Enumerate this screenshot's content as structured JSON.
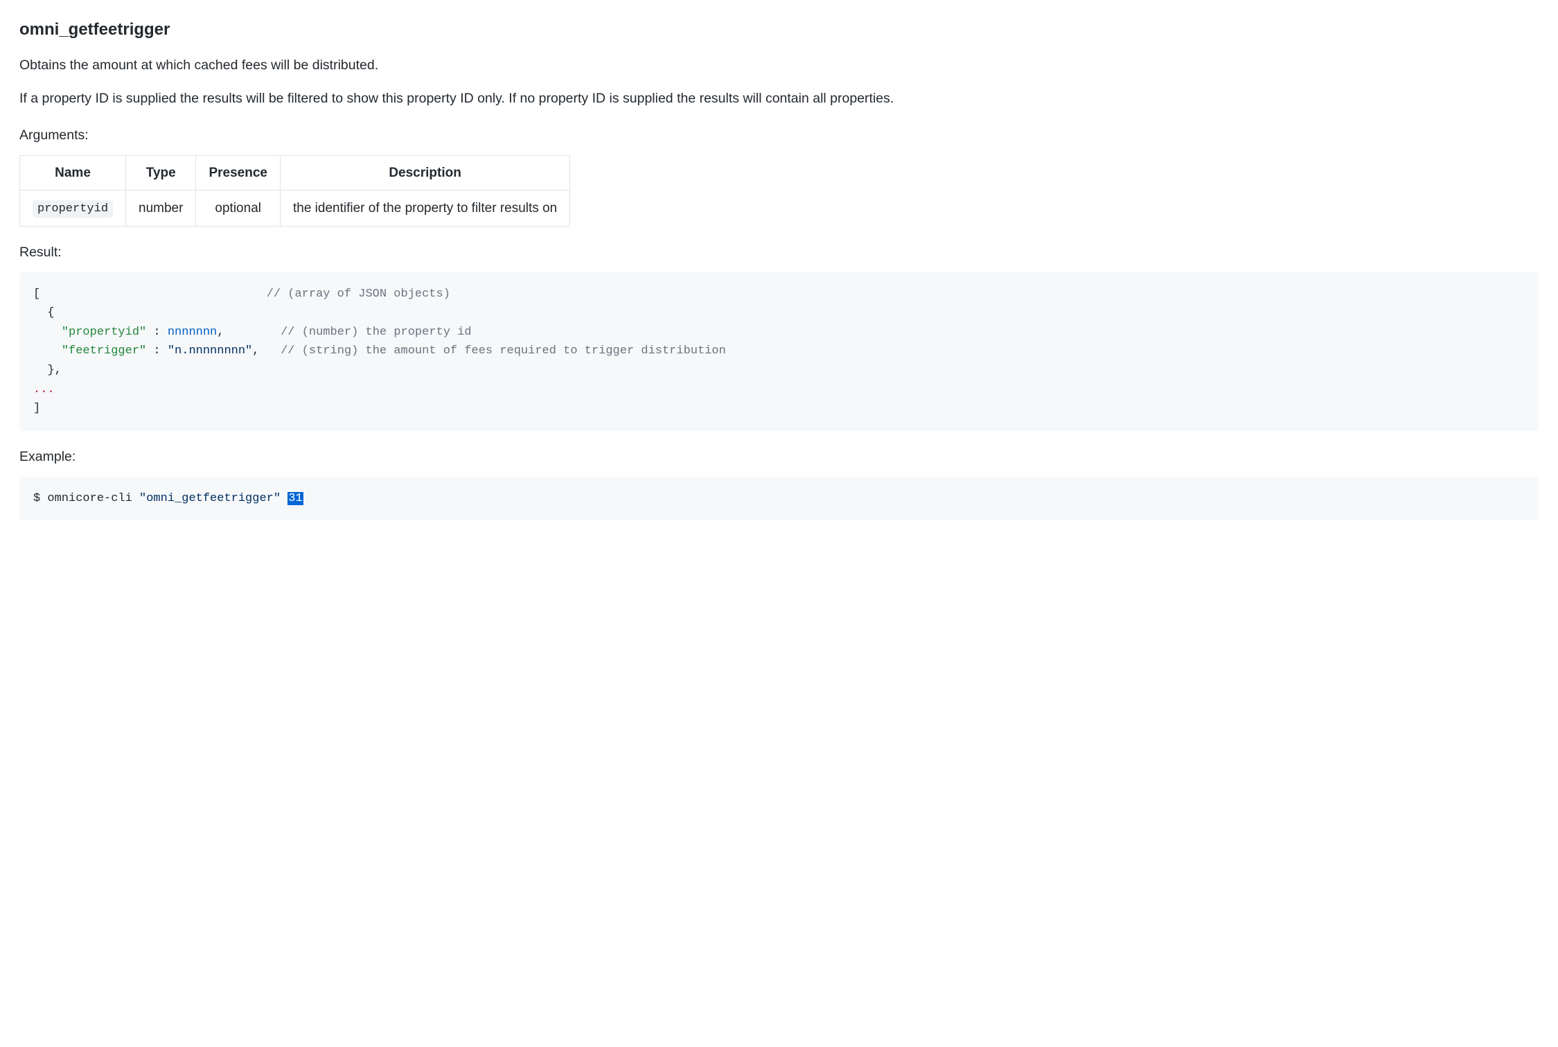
{
  "title": "omni_getfeetrigger",
  "description": [
    "Obtains the amount at which cached fees will be distributed.",
    "If a property ID is supplied the results will be filtered to show this property ID only. If no property ID is supplied the results will contain all properties."
  ],
  "argumentsLabel": "Arguments:",
  "argumentsTable": {
    "headers": [
      "Name",
      "Type",
      "Presence",
      "Description"
    ],
    "rows": [
      {
        "name": "propertyid",
        "type": "number",
        "presence": "optional",
        "description": "the identifier of the property to filter results on"
      }
    ]
  },
  "resultLabel": "Result:",
  "resultCode": {
    "lines": [
      {
        "parts": [
          {
            "t": "[                                ",
            "cls": "tok-p"
          },
          {
            "t": "// (array of JSON objects)",
            "cls": "tok-c"
          }
        ]
      },
      {
        "parts": [
          {
            "t": "  {",
            "cls": "tok-p"
          }
        ]
      },
      {
        "parts": [
          {
            "t": "    ",
            "cls": ""
          },
          {
            "t": "\"propertyid\"",
            "cls": "tok-nt"
          },
          {
            "t": " : ",
            "cls": "tok-p"
          },
          {
            "t": "nnnnnnn",
            "cls": "tok-mi"
          },
          {
            "t": ",        ",
            "cls": "tok-p"
          },
          {
            "t": "// (number) the property id",
            "cls": "tok-c"
          }
        ]
      },
      {
        "parts": [
          {
            "t": "    ",
            "cls": ""
          },
          {
            "t": "\"feetrigger\"",
            "cls": "tok-nt"
          },
          {
            "t": " : ",
            "cls": "tok-p"
          },
          {
            "t": "\"n.nnnnnnnn\"",
            "cls": "tok-s"
          },
          {
            "t": ",   ",
            "cls": "tok-p"
          },
          {
            "t": "// (string) the amount of fees required to trigger distribution",
            "cls": "tok-c"
          }
        ]
      },
      {
        "parts": [
          {
            "t": "  },",
            "cls": "tok-p"
          }
        ]
      },
      {
        "parts": [
          {
            "t": "...",
            "cls": "tok-err"
          }
        ]
      },
      {
        "parts": [
          {
            "t": "]",
            "cls": "tok-p"
          }
        ]
      }
    ]
  },
  "exampleLabel": "Example:",
  "exampleCode": {
    "prompt": "$ ",
    "cmd": "omnicore-cli ",
    "arg1": "\"omni_getfeetrigger\"",
    "space": " ",
    "arg2": "31"
  }
}
